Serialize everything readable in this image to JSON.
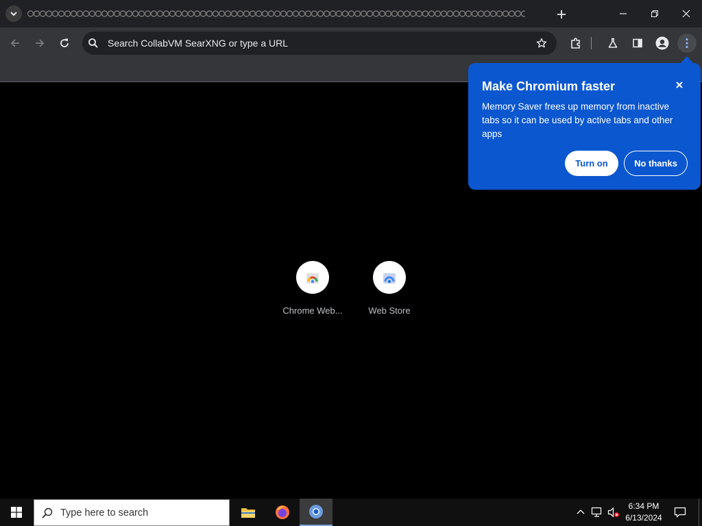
{
  "browser": {
    "omnibox": {
      "placeholder": "Search CollabVM SearXNG or type a URL"
    }
  },
  "shortcuts": [
    {
      "label": "Chrome Web..."
    },
    {
      "label": "Web Store"
    }
  ],
  "promo": {
    "title": "Make Chromium faster",
    "body": "Memory Saver frees up memory from inactive tabs so it can be used by active tabs and other apps",
    "turn_on": "Turn on",
    "no_thanks": "No thanks",
    "color": "#0b57d0"
  },
  "taskbar": {
    "search_placeholder": "Type here to search",
    "time": "6:34 PM",
    "date": "6/13/2024"
  }
}
